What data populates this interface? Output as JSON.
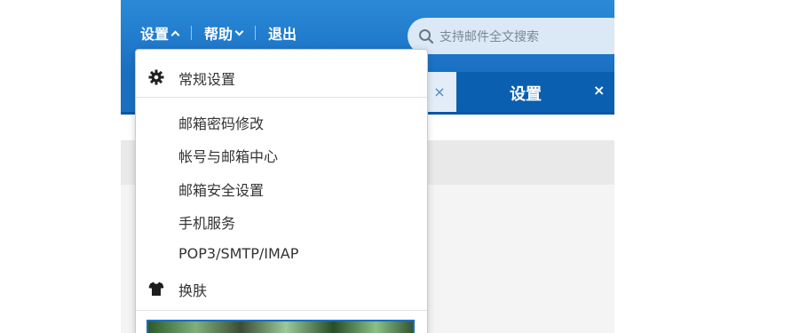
{
  "header": {
    "nav": [
      {
        "label": "设置",
        "chevron": "up"
      },
      {
        "label": "帮助",
        "chevron": "down"
      },
      {
        "label": "退出"
      }
    ],
    "search": {
      "placeholder": "支持邮件全文搜索"
    }
  },
  "tabs": {
    "active": {
      "label": "设置",
      "close": "×"
    },
    "inactive_close": "×"
  },
  "settings_menu": {
    "items": [
      {
        "label": "常规设置",
        "icon": "gear-icon"
      },
      {
        "label": "邮箱密码修改"
      },
      {
        "label": "帐号与邮箱中心"
      },
      {
        "label": "邮箱安全设置"
      },
      {
        "label": "手机服务"
      },
      {
        "label": "POP3/SMTP/IMAP"
      },
      {
        "label": "换肤",
        "icon": "tshirt-icon"
      }
    ]
  },
  "colors": {
    "header_blue": "#1a6fc2",
    "active_tab": "#0a5fb0",
    "menu_text": "#333333"
  }
}
